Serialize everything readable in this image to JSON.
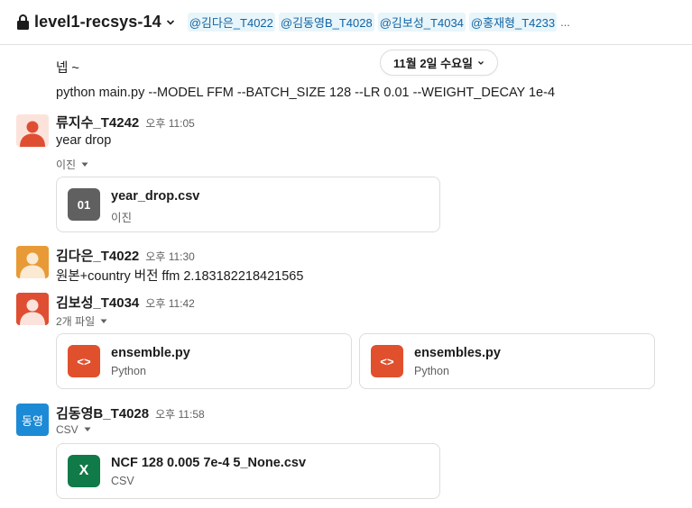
{
  "header": {
    "channel": "level1-recsys-14",
    "members": [
      "@김다은_T4022",
      "@김동영B_T4028",
      "@김보성_T4034",
      "@홍재형_T4233"
    ],
    "more": "..."
  },
  "date_divider": "11월 2일 수요일",
  "top_messages": {
    "line1": "넵 ~",
    "line2": "python main.py --MODEL FFM --BATCH_SIZE 128 --LR 0.01 --WEIGHT_DECAY 1e-4"
  },
  "messages": [
    {
      "sender": "류지수_T4242",
      "time": "오후 11:05",
      "text": "year drop",
      "toggle": "이진",
      "files": [
        {
          "name": "year_drop.csv",
          "type": "이진",
          "icon": "01"
        }
      ]
    },
    {
      "sender": "김다은_T4022",
      "time": "오후 11:30",
      "text": "원본+country 버전 ffm 2.183182218421565"
    },
    {
      "sender": "김보성_T4034",
      "time": "오후 11:42",
      "toggle": "2개 파일",
      "files": [
        {
          "name": "ensemble.py",
          "type": "Python",
          "icon": "<>"
        },
        {
          "name": "ensembles.py",
          "type": "Python",
          "icon": "<>"
        }
      ]
    },
    {
      "sender": "김동영B_T4028",
      "time": "오후 11:58",
      "avatar_text": "동영",
      "toggle": "CSV",
      "files": [
        {
          "name": "NCF 128 0.005 7e-4 5_None.csv",
          "type": "CSV",
          "icon": "X"
        }
      ]
    }
  ],
  "colors": {
    "mention_bg": "#e8f5fa",
    "mention_text": "#1264a3",
    "binary_icon": "#616061",
    "code_icon": "#e0502d",
    "csv_icon": "#107a48",
    "avatar_blue": "#1d8ad6",
    "avatar_orange": "#e89a36",
    "avatar_red": "#df4e32"
  }
}
